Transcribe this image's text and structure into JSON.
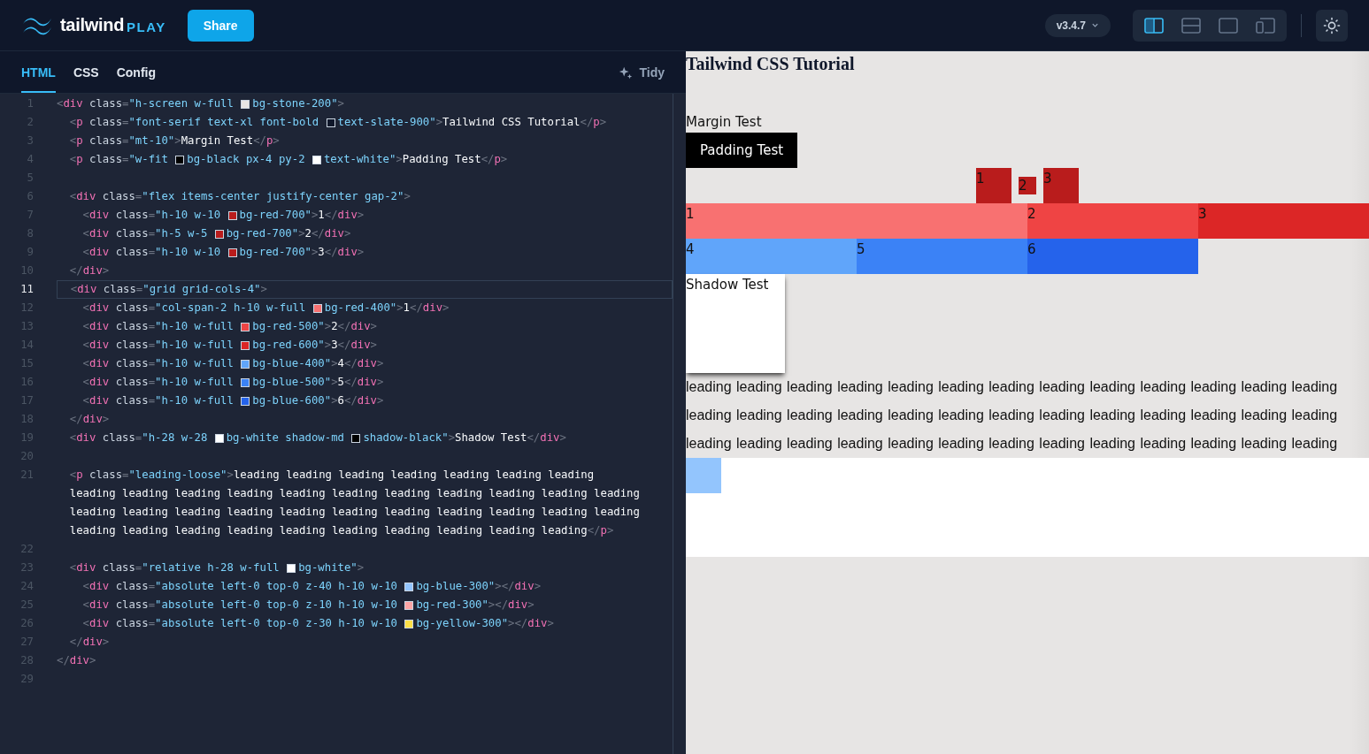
{
  "header": {
    "logo": {
      "word": "tailwind",
      "suffix": "PLAY"
    },
    "share_button": "Share",
    "version": "v3.4.7",
    "layout_options": [
      {
        "kind": "split",
        "selected": true
      },
      {
        "kind": "stacked",
        "selected": false
      },
      {
        "kind": "single",
        "selected": false
      },
      {
        "kind": "responsive",
        "selected": false
      }
    ]
  },
  "editor": {
    "tabs": [
      {
        "label": "HTML",
        "selected": true
      },
      {
        "label": "CSS",
        "selected": false
      },
      {
        "label": "Config",
        "selected": false
      }
    ],
    "tidy_button": "Tidy",
    "lines": [
      {
        "number": "1",
        "current": false,
        "rows": [
          {
            "tokens": [
              {
                "kind": "punct",
                "text": "<"
              },
              {
                "kind": "tag",
                "text": "div"
              },
              {
                "kind": "attr",
                "text": " class"
              },
              {
                "kind": "punct",
                "text": "="
              },
              {
                "kind": "str",
                "text": "\"h-screen w-full "
              },
              {
                "kind": "swatch",
                "color": "#e7e5e4"
              },
              {
                "kind": "str",
                "text": "bg-stone-200\""
              },
              {
                "kind": "punct",
                "text": ">"
              }
            ]
          }
        ]
      },
      {
        "number": "2",
        "current": false,
        "rows": [
          {
            "tokens": [
              {
                "kind": "punct",
                "text": "  <"
              },
              {
                "kind": "tag",
                "text": "p"
              },
              {
                "kind": "attr",
                "text": " class"
              },
              {
                "kind": "punct",
                "text": "="
              },
              {
                "kind": "str",
                "text": "\"font-serif text-xl font-bold "
              },
              {
                "kind": "swatch",
                "color": "#0f172a"
              },
              {
                "kind": "str",
                "text": "text-slate-900\""
              },
              {
                "kind": "punct",
                "text": ">"
              },
              {
                "kind": "text",
                "text": "Tailwind CSS Tutorial"
              },
              {
                "kind": "punct",
                "text": "</"
              },
              {
                "kind": "tag",
                "text": "p"
              },
              {
                "kind": "punct",
                "text": ">"
              }
            ]
          }
        ]
      },
      {
        "number": "3",
        "current": false,
        "rows": [
          {
            "tokens": [
              {
                "kind": "punct",
                "text": "  <"
              },
              {
                "kind": "tag",
                "text": "p"
              },
              {
                "kind": "attr",
                "text": " class"
              },
              {
                "kind": "punct",
                "text": "="
              },
              {
                "kind": "str",
                "text": "\"mt-10\""
              },
              {
                "kind": "punct",
                "text": ">"
              },
              {
                "kind": "text",
                "text": "Margin Test"
              },
              {
                "kind": "punct",
                "text": "</"
              },
              {
                "kind": "tag",
                "text": "p"
              },
              {
                "kind": "punct",
                "text": ">"
              }
            ]
          }
        ]
      },
      {
        "number": "4",
        "current": false,
        "rows": [
          {
            "tokens": [
              {
                "kind": "punct",
                "text": "  <"
              },
              {
                "kind": "tag",
                "text": "p"
              },
              {
                "kind": "attr",
                "text": " class"
              },
              {
                "kind": "punct",
                "text": "="
              },
              {
                "kind": "str",
                "text": "\"w-fit "
              },
              {
                "kind": "swatch",
                "color": "#000000"
              },
              {
                "kind": "str",
                "text": "bg-black px-4 py-2 "
              },
              {
                "kind": "swatch",
                "color": "#ffffff"
              },
              {
                "kind": "str",
                "text": "text-white\""
              },
              {
                "kind": "punct",
                "text": ">"
              },
              {
                "kind": "text",
                "text": "Padding Test"
              },
              {
                "kind": "punct",
                "text": "</"
              },
              {
                "kind": "tag",
                "text": "p"
              },
              {
                "kind": "punct",
                "text": ">"
              }
            ]
          }
        ]
      },
      {
        "number": "5",
        "current": false
      },
      {
        "number": "6",
        "current": false,
        "rows": [
          {
            "tokens": [
              {
                "kind": "punct",
                "text": "  <"
              },
              {
                "kind": "tag",
                "text": "div"
              },
              {
                "kind": "attr",
                "text": " class"
              },
              {
                "kind": "punct",
                "text": "="
              },
              {
                "kind": "str",
                "text": "\"flex items-center justify-center gap-2\""
              },
              {
                "kind": "punct",
                "text": ">"
              }
            ]
          }
        ]
      },
      {
        "number": "7",
        "current": false,
        "rows": [
          {
            "tokens": [
              {
                "kind": "punct",
                "text": "    <"
              },
              {
                "kind": "tag",
                "text": "div"
              },
              {
                "kind": "attr",
                "text": " class"
              },
              {
                "kind": "punct",
                "text": "="
              },
              {
                "kind": "str",
                "text": "\"h-10 w-10 "
              },
              {
                "kind": "swatch",
                "color": "#b91c1c"
              },
              {
                "kind": "str",
                "text": "bg-red-700\""
              },
              {
                "kind": "punct",
                "text": ">"
              },
              {
                "kind": "text",
                "text": "1"
              },
              {
                "kind": "punct",
                "text": "</"
              },
              {
                "kind": "tag",
                "text": "div"
              },
              {
                "kind": "punct",
                "text": ">"
              }
            ]
          }
        ]
      },
      {
        "number": "8",
        "current": false,
        "rows": [
          {
            "tokens": [
              {
                "kind": "punct",
                "text": "    <"
              },
              {
                "kind": "tag",
                "text": "div"
              },
              {
                "kind": "attr",
                "text": " class"
              },
              {
                "kind": "punct",
                "text": "="
              },
              {
                "kind": "str",
                "text": "\"h-5 w-5 "
              },
              {
                "kind": "swatch",
                "color": "#b91c1c"
              },
              {
                "kind": "str",
                "text": "bg-red-700\""
              },
              {
                "kind": "punct",
                "text": ">"
              },
              {
                "kind": "text",
                "text": "2"
              },
              {
                "kind": "punct",
                "text": "</"
              },
              {
                "kind": "tag",
                "text": "div"
              },
              {
                "kind": "punct",
                "text": ">"
              }
            ]
          }
        ]
      },
      {
        "number": "9",
        "current": false,
        "rows": [
          {
            "tokens": [
              {
                "kind": "punct",
                "text": "    <"
              },
              {
                "kind": "tag",
                "text": "div"
              },
              {
                "kind": "attr",
                "text": " class"
              },
              {
                "kind": "punct",
                "text": "="
              },
              {
                "kind": "str",
                "text": "\"h-10 w-10 "
              },
              {
                "kind": "swatch",
                "color": "#b91c1c"
              },
              {
                "kind": "str",
                "text": "bg-red-700\""
              },
              {
                "kind": "punct",
                "text": ">"
              },
              {
                "kind": "text",
                "text": "3"
              },
              {
                "kind": "punct",
                "text": "</"
              },
              {
                "kind": "tag",
                "text": "div"
              },
              {
                "kind": "punct",
                "text": ">"
              }
            ]
          }
        ]
      },
      {
        "number": "10",
        "current": false,
        "rows": [
          {
            "tokens": [
              {
                "kind": "punct",
                "text": "  </"
              },
              {
                "kind": "tag",
                "text": "div"
              },
              {
                "kind": "punct",
                "text": ">"
              }
            ]
          }
        ]
      },
      {
        "number": "11",
        "current": true,
        "rows": [
          {
            "tokens": [
              {
                "kind": "punct",
                "text": "  <"
              },
              {
                "kind": "tag",
                "text": "div"
              },
              {
                "kind": "attr",
                "text": " class"
              },
              {
                "kind": "punct",
                "text": "="
              },
              {
                "kind": "str",
                "text": "\"grid grid-cols-4\""
              },
              {
                "kind": "punct",
                "text": ">"
              }
            ]
          }
        ]
      },
      {
        "number": "12",
        "current": false,
        "rows": [
          {
            "tokens": [
              {
                "kind": "punct",
                "text": "    <"
              },
              {
                "kind": "tag",
                "text": "div"
              },
              {
                "kind": "attr",
                "text": " class"
              },
              {
                "kind": "punct",
                "text": "="
              },
              {
                "kind": "str",
                "text": "\"col-span-2 h-10 w-full "
              },
              {
                "kind": "swatch",
                "color": "#f87171"
              },
              {
                "kind": "str",
                "text": "bg-red-400\""
              },
              {
                "kind": "punct",
                "text": ">"
              },
              {
                "kind": "text",
                "text": "1"
              },
              {
                "kind": "punct",
                "text": "</"
              },
              {
                "kind": "tag",
                "text": "div"
              },
              {
                "kind": "punct",
                "text": ">"
              }
            ]
          }
        ]
      },
      {
        "number": "13",
        "current": false,
        "rows": [
          {
            "tokens": [
              {
                "kind": "punct",
                "text": "    <"
              },
              {
                "kind": "tag",
                "text": "div"
              },
              {
                "kind": "attr",
                "text": " class"
              },
              {
                "kind": "punct",
                "text": "="
              },
              {
                "kind": "str",
                "text": "\"h-10 w-full "
              },
              {
                "kind": "swatch",
                "color": "#ef4444"
              },
              {
                "kind": "str",
                "text": "bg-red-500\""
              },
              {
                "kind": "punct",
                "text": ">"
              },
              {
                "kind": "text",
                "text": "2"
              },
              {
                "kind": "punct",
                "text": "</"
              },
              {
                "kind": "tag",
                "text": "div"
              },
              {
                "kind": "punct",
                "text": ">"
              }
            ]
          }
        ]
      },
      {
        "number": "14",
        "current": false,
        "rows": [
          {
            "tokens": [
              {
                "kind": "punct",
                "text": "    <"
              },
              {
                "kind": "tag",
                "text": "div"
              },
              {
                "kind": "attr",
                "text": " class"
              },
              {
                "kind": "punct",
                "text": "="
              },
              {
                "kind": "str",
                "text": "\"h-10 w-full "
              },
              {
                "kind": "swatch",
                "color": "#dc2626"
              },
              {
                "kind": "str",
                "text": "bg-red-600\""
              },
              {
                "kind": "punct",
                "text": ">"
              },
              {
                "kind": "text",
                "text": "3"
              },
              {
                "kind": "punct",
                "text": "</"
              },
              {
                "kind": "tag",
                "text": "div"
              },
              {
                "kind": "punct",
                "text": ">"
              }
            ]
          }
        ]
      },
      {
        "number": "15",
        "current": false,
        "rows": [
          {
            "tokens": [
              {
                "kind": "punct",
                "text": "    <"
              },
              {
                "kind": "tag",
                "text": "div"
              },
              {
                "kind": "attr",
                "text": " class"
              },
              {
                "kind": "punct",
                "text": "="
              },
              {
                "kind": "str",
                "text": "\"h-10 w-full "
              },
              {
                "kind": "swatch",
                "color": "#60a5fa"
              },
              {
                "kind": "str",
                "text": "bg-blue-400\""
              },
              {
                "kind": "punct",
                "text": ">"
              },
              {
                "kind": "text",
                "text": "4"
              },
              {
                "kind": "punct",
                "text": "</"
              },
              {
                "kind": "tag",
                "text": "div"
              },
              {
                "kind": "punct",
                "text": ">"
              }
            ]
          }
        ]
      },
      {
        "number": "16",
        "current": false,
        "rows": [
          {
            "tokens": [
              {
                "kind": "punct",
                "text": "    <"
              },
              {
                "kind": "tag",
                "text": "div"
              },
              {
                "kind": "attr",
                "text": " class"
              },
              {
                "kind": "punct",
                "text": "="
              },
              {
                "kind": "str",
                "text": "\"h-10 w-full "
              },
              {
                "kind": "swatch",
                "color": "#3b82f6"
              },
              {
                "kind": "str",
                "text": "bg-blue-500\""
              },
              {
                "kind": "punct",
                "text": ">"
              },
              {
                "kind": "text",
                "text": "5"
              },
              {
                "kind": "punct",
                "text": "</"
              },
              {
                "kind": "tag",
                "text": "div"
              },
              {
                "kind": "punct",
                "text": ">"
              }
            ]
          }
        ]
      },
      {
        "number": "17",
        "current": false,
        "rows": [
          {
            "tokens": [
              {
                "kind": "punct",
                "text": "    <"
              },
              {
                "kind": "tag",
                "text": "div"
              },
              {
                "kind": "attr",
                "text": " class"
              },
              {
                "kind": "punct",
                "text": "="
              },
              {
                "kind": "str",
                "text": "\"h-10 w-full "
              },
              {
                "kind": "swatch",
                "color": "#2563eb"
              },
              {
                "kind": "str",
                "text": "bg-blue-600\""
              },
              {
                "kind": "punct",
                "text": ">"
              },
              {
                "kind": "text",
                "text": "6"
              },
              {
                "kind": "punct",
                "text": "</"
              },
              {
                "kind": "tag",
                "text": "div"
              },
              {
                "kind": "punct",
                "text": ">"
              }
            ]
          }
        ]
      },
      {
        "number": "18",
        "current": false,
        "rows": [
          {
            "tokens": [
              {
                "kind": "punct",
                "text": "  </"
              },
              {
                "kind": "tag",
                "text": "div"
              },
              {
                "kind": "punct",
                "text": ">"
              }
            ]
          }
        ]
      },
      {
        "number": "19",
        "current": false,
        "rows": [
          {
            "tokens": [
              {
                "kind": "punct",
                "text": "  <"
              },
              {
                "kind": "tag",
                "text": "div"
              },
              {
                "kind": "attr",
                "text": " class"
              },
              {
                "kind": "punct",
                "text": "="
              },
              {
                "kind": "str",
                "text": "\"h-28 w-28 "
              },
              {
                "kind": "swatch",
                "color": "#ffffff"
              },
              {
                "kind": "str",
                "text": "bg-white shadow-md "
              },
              {
                "kind": "swatch",
                "color": "#000000"
              },
              {
                "kind": "str",
                "text": "shadow-black\""
              },
              {
                "kind": "punct",
                "text": ">"
              },
              {
                "kind": "text",
                "text": "Shadow Test"
              },
              {
                "kind": "punct",
                "text": "</"
              },
              {
                "kind": "tag",
                "text": "div"
              },
              {
                "kind": "punct",
                "text": ">"
              }
            ]
          }
        ]
      },
      {
        "number": "20",
        "current": false
      },
      {
        "number": "21",
        "current": false,
        "rows": [
          {
            "tokens": [
              {
                "kind": "punct",
                "text": "  <"
              },
              {
                "kind": "tag",
                "text": "p"
              },
              {
                "kind": "attr",
                "text": " class"
              },
              {
                "kind": "punct",
                "text": "="
              },
              {
                "kind": "str",
                "text": "\"leading-loose\""
              },
              {
                "kind": "punct",
                "text": ">"
              },
              {
                "kind": "text",
                "text": "leading leading leading leading leading leading leading"
              }
            ]
          },
          {
            "tokens": [
              {
                "kind": "text",
                "text": "  leading leading leading leading leading leading leading leading leading leading leading"
              }
            ]
          },
          {
            "tokens": [
              {
                "kind": "text",
                "text": "  leading leading leading leading leading leading leading leading leading leading leading"
              }
            ]
          },
          {
            "tokens": [
              {
                "kind": "text",
                "text": "  leading leading leading leading leading leading leading leading leading leading"
              },
              {
                "kind": "punct",
                "text": "</"
              },
              {
                "kind": "tag",
                "text": "p"
              },
              {
                "kind": "punct",
                "text": ">"
              }
            ]
          }
        ]
      },
      {
        "number": "22",
        "current": false
      },
      {
        "number": "23",
        "current": false,
        "rows": [
          {
            "tokens": [
              {
                "kind": "punct",
                "text": "  <"
              },
              {
                "kind": "tag",
                "text": "div"
              },
              {
                "kind": "attr",
                "text": " class"
              },
              {
                "kind": "punct",
                "text": "="
              },
              {
                "kind": "str",
                "text": "\"relative h-28 w-full "
              },
              {
                "kind": "swatch",
                "color": "#ffffff"
              },
              {
                "kind": "str",
                "text": "bg-white\""
              },
              {
                "kind": "punct",
                "text": ">"
              }
            ]
          }
        ]
      },
      {
        "number": "24",
        "current": false,
        "rows": [
          {
            "tokens": [
              {
                "kind": "punct",
                "text": "    <"
              },
              {
                "kind": "tag",
                "text": "div"
              },
              {
                "kind": "attr",
                "text": " class"
              },
              {
                "kind": "punct",
                "text": "="
              },
              {
                "kind": "str",
                "text": "\"absolute left-0 top-0 z-40 h-10 w-10 "
              },
              {
                "kind": "swatch",
                "color": "#93c5fd"
              },
              {
                "kind": "str",
                "text": "bg-blue-300\""
              },
              {
                "kind": "punct",
                "text": "></"
              },
              {
                "kind": "tag",
                "text": "div"
              },
              {
                "kind": "punct",
                "text": ">"
              }
            ]
          }
        ]
      },
      {
        "number": "25",
        "current": false,
        "rows": [
          {
            "tokens": [
              {
                "kind": "punct",
                "text": "    <"
              },
              {
                "kind": "tag",
                "text": "div"
              },
              {
                "kind": "attr",
                "text": " class"
              },
              {
                "kind": "punct",
                "text": "="
              },
              {
                "kind": "str",
                "text": "\"absolute left-0 top-0 z-10 h-10 w-10 "
              },
              {
                "kind": "swatch",
                "color": "#fca5a5"
              },
              {
                "kind": "str",
                "text": "bg-red-300\""
              },
              {
                "kind": "punct",
                "text": "></"
              },
              {
                "kind": "tag",
                "text": "div"
              },
              {
                "kind": "punct",
                "text": ">"
              }
            ]
          }
        ]
      },
      {
        "number": "26",
        "current": false,
        "rows": [
          {
            "tokens": [
              {
                "kind": "punct",
                "text": "    <"
              },
              {
                "kind": "tag",
                "text": "div"
              },
              {
                "kind": "attr",
                "text": " class"
              },
              {
                "kind": "punct",
                "text": "="
              },
              {
                "kind": "str",
                "text": "\"absolute left-0 top-0 z-30 h-10 w-10 "
              },
              {
                "kind": "swatch",
                "color": "#fde047"
              },
              {
                "kind": "str",
                "text": "bg-yellow-300\""
              },
              {
                "kind": "punct",
                "text": "></"
              },
              {
                "kind": "tag",
                "text": "div"
              },
              {
                "kind": "punct",
                "text": ">"
              }
            ]
          }
        ]
      },
      {
        "number": "27",
        "current": false,
        "rows": [
          {
            "tokens": [
              {
                "kind": "punct",
                "text": "  </"
              },
              {
                "kind": "tag",
                "text": "div"
              },
              {
                "kind": "punct",
                "text": ">"
              }
            ]
          }
        ]
      },
      {
        "number": "28",
        "current": false,
        "rows": [
          {
            "tokens": [
              {
                "kind": "punct",
                "text": "</"
              },
              {
                "kind": "tag",
                "text": "div"
              },
              {
                "kind": "punct",
                "text": ">"
              }
            ]
          }
        ]
      },
      {
        "number": "29",
        "current": false
      }
    ]
  },
  "preview": {
    "title": "Tailwind CSS Tutorial",
    "margin_text": "Margin Test",
    "padding_text": "Padding Test",
    "flex_items": [
      {
        "label": "1",
        "kind": "large"
      },
      {
        "label": "2",
        "kind": "small"
      },
      {
        "label": "3",
        "kind": "large"
      }
    ],
    "grid_cells": [
      {
        "label": "1",
        "kind": "wide",
        "color": "#f87171"
      },
      {
        "label": "2",
        "kind": "normal",
        "color": "#ef4444"
      },
      {
        "label": "3",
        "kind": "normal",
        "color": "#dc2626"
      },
      {
        "label": "4",
        "kind": "normal",
        "color": "#60a5fa"
      },
      {
        "label": "5",
        "kind": "normal",
        "color": "#3b82f6"
      },
      {
        "label": "6",
        "kind": "normal",
        "color": "#2563eb"
      }
    ],
    "shadow_card": "Shadow Test",
    "paragraph": "leading leading leading leading leading leading leading leading leading leading leading leading leading leading leading leading leading leading leading leading leading leading leading leading leading leading leading leading leading leading leading leading leading leading leading leading leading leading leading"
  }
}
